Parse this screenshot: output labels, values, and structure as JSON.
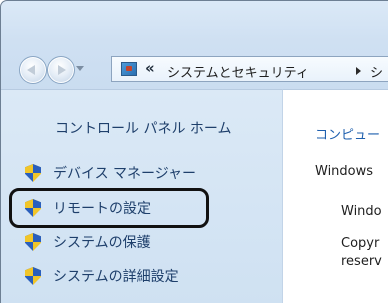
{
  "address_bar": {
    "separator": "«",
    "path": "システムとセキュリティ",
    "next_truncated": "シ"
  },
  "sidebar": {
    "home_label": "コントロール パネル ホーム",
    "items": [
      {
        "label": "デバイス マネージャー",
        "icon": "uac-shield-icon"
      },
      {
        "label": "リモートの設定",
        "icon": "uac-shield-icon",
        "highlighted": true
      },
      {
        "label": "システムの保護",
        "icon": "uac-shield-icon"
      },
      {
        "label": "システムの詳細設定",
        "icon": "uac-shield-icon"
      }
    ]
  },
  "content": {
    "heading_truncated": "コンピュー",
    "line1": "Windows",
    "line2": "Windo",
    "line3": "Copyr",
    "line4": "reserv"
  },
  "colors": {
    "link": "#1e3f6b",
    "content_heading": "#1e5fae",
    "sidebar_bg": "#cfe1f2",
    "highlight_border": "#111111"
  }
}
